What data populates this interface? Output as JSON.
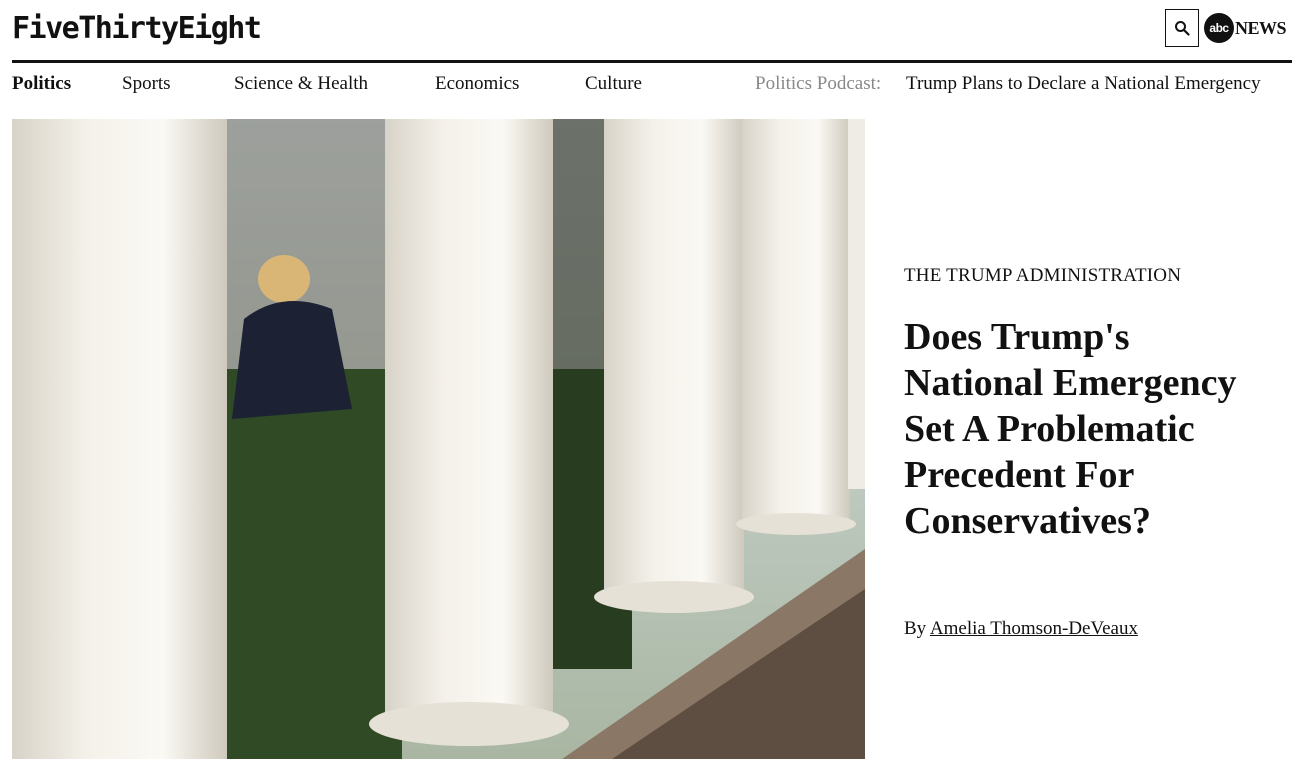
{
  "header": {
    "logo": "FiveThirtyEight",
    "search_icon": "search-icon",
    "partner_logo_circle": "abc",
    "partner_logo_text": "NEWS"
  },
  "nav": {
    "items": [
      {
        "label": "Politics",
        "active": true
      },
      {
        "label": "Sports",
        "active": false
      },
      {
        "label": "Science & Health",
        "active": false
      },
      {
        "label": "Economics",
        "active": false
      },
      {
        "label": "Culture",
        "active": false
      }
    ],
    "podcast_label": "Politics Podcast:",
    "podcast_title": "Trump Plans to Declare a National Emergency"
  },
  "article": {
    "kicker": "THE TRUMP ADMINISTRATION",
    "headline": "Does Trump's National Emergency Set A Problematic Precedent For Conservatives?",
    "byline_prefix": "By",
    "author": "Amelia Thomson-DeVeaux"
  },
  "colors": {
    "text": "#111111",
    "muted": "#888888",
    "rule": "#111111"
  }
}
